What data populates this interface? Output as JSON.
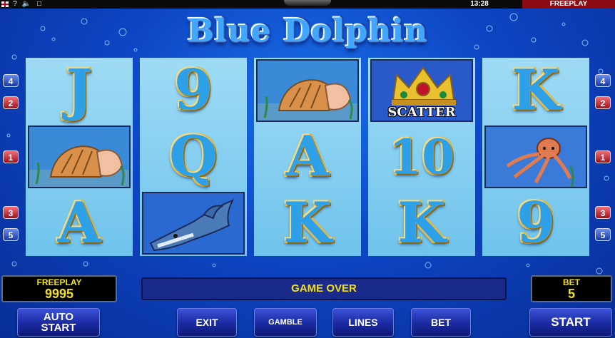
{
  "topbar": {
    "help_label": "?",
    "sound_icon": "speaker-icon",
    "fullscreen_icon": "fullscreen-icon",
    "time": "13:28",
    "mode": "FREEPLAY"
  },
  "logo": {
    "text": "Blue Dolphin"
  },
  "reels": [
    [
      {
        "type": "text",
        "value": "J"
      },
      {
        "type": "image",
        "value": "shell"
      },
      {
        "type": "text",
        "value": "A"
      }
    ],
    [
      {
        "type": "text",
        "value": "9"
      },
      {
        "type": "text",
        "value": "Q"
      },
      {
        "type": "image",
        "value": "dolphin"
      }
    ],
    [
      {
        "type": "image",
        "value": "shell"
      },
      {
        "type": "text",
        "value": "A"
      },
      {
        "type": "text",
        "value": "K"
      }
    ],
    [
      {
        "type": "image",
        "value": "scatter",
        "label": "SCATTER"
      },
      {
        "type": "text",
        "value": "10"
      },
      {
        "type": "text",
        "value": "K"
      }
    ],
    [
      {
        "type": "text",
        "value": "K"
      },
      {
        "type": "image",
        "value": "octopus"
      },
      {
        "type": "text",
        "value": "9"
      }
    ]
  ],
  "line_buttons": {
    "left": [
      "4",
      "2",
      "1",
      "3",
      "5"
    ],
    "right": [
      "4",
      "2",
      "1",
      "3",
      "5"
    ]
  },
  "balance": {
    "label": "FREEPLAY",
    "value": "9995"
  },
  "message": "GAME OVER",
  "bet": {
    "label": "BET",
    "value": "5"
  },
  "buttons": {
    "auto_start_line1": "AUTO",
    "auto_start_line2": "START",
    "exit": "EXIT",
    "gamble": "GAMBLE",
    "lines": "LINES",
    "bet": "BET",
    "start": "START"
  },
  "colors": {
    "background": "#0d45c4",
    "reel": "#8fd2f2",
    "panel_text": "#f0e020",
    "mode_badge": "#8a0c12"
  }
}
